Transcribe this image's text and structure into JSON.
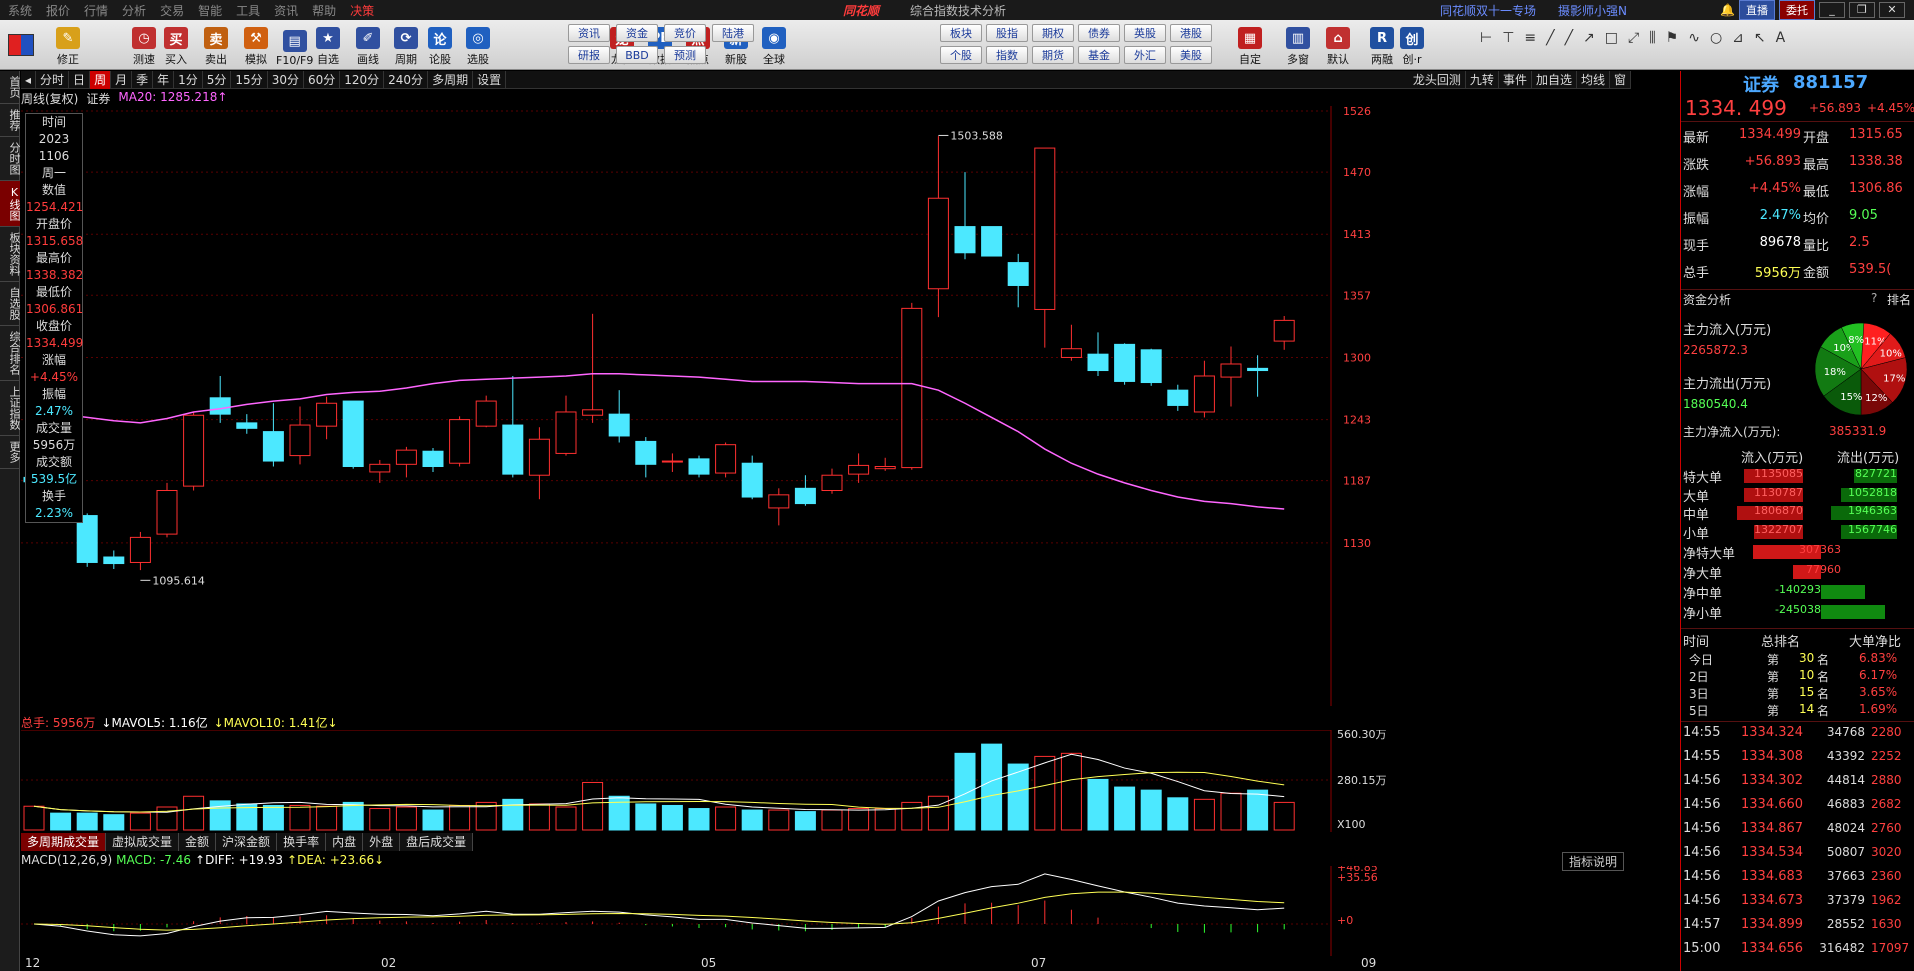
{
  "menu": [
    "系统",
    "报价",
    "行情",
    "分析",
    "交易",
    "智能",
    "工具",
    "资讯",
    "帮助",
    "决策"
  ],
  "brand": "同花顺",
  "window_title": "综合指数技术分析",
  "promo": "同花顺双十一专场",
  "promo2": "摄影师小强N",
  "top_buttons": {
    "live": "直播",
    "entrust": "委托"
  },
  "toolbar": {
    "buttons": [
      "修正",
      "测速",
      "买入",
      "卖出",
      "模拟",
      "F10/F9",
      "自选",
      "画线",
      "周期",
      "论股",
      "选股",
      "龙虎",
      "数据",
      "热点",
      "新股",
      "全球",
      "自定",
      "多窗",
      "默认",
      "两融",
      "创·r"
    ],
    "small": [
      "资讯",
      "资金",
      "竞价",
      "陆港",
      "研报",
      "BBD",
      "预测",
      "板块",
      "股指",
      "期权",
      "债券",
      "英股",
      "港股",
      "个股",
      "指数",
      "期货",
      "基金",
      "外汇",
      "美股"
    ]
  },
  "left_tabs": [
    "首页",
    "推荐",
    "分时图",
    "K线图",
    "板块资料",
    "自选股",
    "综合排名",
    "上证指数",
    "更多"
  ],
  "period_tabs": [
    "分时",
    "日",
    "周",
    "月",
    "季",
    "年",
    "1分",
    "5分",
    "15分",
    "30分",
    "60分",
    "120分",
    "240分",
    "多周期",
    "设置"
  ],
  "period_active": "周",
  "period_right": [
    "龙头回测",
    "九转",
    "事件",
    "加自选",
    "均线",
    "窗"
  ],
  "chart_info": {
    "type": "周线(复权)",
    "name": "证券",
    "ma": "MA20: 1285.218"
  },
  "info_box": [
    {
      "k": "时间",
      "v": "2023",
      "c": "white"
    },
    {
      "k": "",
      "v": "1106",
      "c": "white"
    },
    {
      "k": "周一",
      "v": "",
      "c": "white"
    },
    {
      "k": "数值",
      "v": "1254.421",
      "c": "red"
    },
    {
      "k": "开盘价",
      "v": "1315.658",
      "c": "red"
    },
    {
      "k": "最高价",
      "v": "1338.382",
      "c": "red"
    },
    {
      "k": "最低价",
      "v": "1306.861",
      "c": "red"
    },
    {
      "k": "收盘价",
      "v": "1334.499",
      "c": "red"
    },
    {
      "k": "涨幅",
      "v": "+4.45%",
      "c": "red"
    },
    {
      "k": "振幅",
      "v": "2.47%",
      "c": "cyan"
    },
    {
      "k": "成交量",
      "v": "5956万",
      "c": "white"
    },
    {
      "k": "成交额",
      "v": "539.5亿",
      "c": "cyan"
    },
    {
      "k": "换手",
      "v": "2.23%",
      "c": "cyan"
    }
  ],
  "chart_data": [
    {
      "type": "candlestick",
      "title": "",
      "ylim": [
        1095,
        1526
      ],
      "y_ticks": [
        "1526",
        "1470",
        "1413",
        "1357",
        "1300",
        "1243",
        "1187",
        "1130"
      ],
      "annotations": {
        "high": "1503.588",
        "low": "1095.614"
      },
      "candles": [
        [
          1190,
          1186,
          1215,
          1178
        ],
        [
          1175,
          1155,
          1176,
          1150
        ],
        [
          1155,
          1112,
          1157,
          1108
        ],
        [
          1117,
          1111,
          1123,
          1106
        ],
        [
          1112,
          1135,
          1140,
          1105
        ],
        [
          1138,
          1178,
          1185,
          1135
        ],
        [
          1182,
          1247,
          1250,
          1178
        ],
        [
          1263,
          1248,
          1283,
          1240
        ],
        [
          1240,
          1235,
          1248,
          1230
        ],
        [
          1232,
          1205,
          1258,
          1200
        ],
        [
          1210,
          1238,
          1255,
          1202
        ],
        [
          1237,
          1258,
          1264,
          1225
        ],
        [
          1260,
          1200,
          1260,
          1198
        ],
        [
          1195,
          1202,
          1206,
          1185
        ],
        [
          1202,
          1215,
          1218,
          1190
        ],
        [
          1214,
          1200,
          1217,
          1195
        ],
        [
          1203,
          1243,
          1246,
          1200
        ],
        [
          1237,
          1260,
          1265,
          1236
        ],
        [
          1238,
          1193,
          1283,
          1190
        ],
        [
          1192,
          1225,
          1236,
          1170
        ],
        [
          1212,
          1250,
          1265,
          1210
        ],
        [
          1247,
          1252,
          1340,
          1240
        ],
        [
          1248,
          1228,
          1270,
          1222
        ],
        [
          1223,
          1202,
          1227,
          1190
        ],
        [
          1205,
          1205,
          1212,
          1195
        ],
        [
          1207,
          1193,
          1210,
          1190
        ],
        [
          1194,
          1220,
          1222,
          1190
        ],
        [
          1203,
          1172,
          1210,
          1170
        ],
        [
          1162,
          1174,
          1180,
          1146
        ],
        [
          1180,
          1166,
          1192,
          1164
        ],
        [
          1178,
          1192,
          1198,
          1175
        ],
        [
          1193,
          1201,
          1212,
          1185
        ],
        [
          1198,
          1200,
          1208,
          1196
        ],
        [
          1199,
          1345,
          1350,
          1197
        ],
        [
          1363,
          1446,
          1503,
          1337
        ],
        [
          1420,
          1396,
          1470,
          1390
        ],
        [
          1420,
          1393,
          1420,
          1393
        ],
        [
          1387,
          1366,
          1395,
          1346
        ],
        [
          1344,
          1492,
          1492,
          1309
        ],
        [
          1300,
          1308,
          1330,
          1297
        ],
        [
          1303,
          1288,
          1323,
          1283
        ],
        [
          1312,
          1278,
          1313,
          1275
        ],
        [
          1307,
          1277,
          1308,
          1274
        ],
        [
          1270,
          1256,
          1275,
          1251
        ],
        [
          1250,
          1283,
          1297,
          1245
        ],
        [
          1282,
          1294,
          1310,
          1255
        ],
        [
          1290,
          1288,
          1302,
          1264
        ],
        [
          1315,
          1334,
          1338,
          1307
        ]
      ],
      "ma20": [
        1248,
        1248,
        1245,
        1242,
        1240,
        1244,
        1250,
        1253,
        1257,
        1260,
        1262,
        1266,
        1268,
        1269,
        1272,
        1276,
        1279,
        1280,
        1281,
        1282,
        1283,
        1285,
        1285,
        1284,
        1283,
        1282,
        1280,
        1278,
        1278,
        1278,
        1277,
        1276,
        1276,
        1276,
        1270,
        1258,
        1245,
        1232,
        1216,
        1203,
        1193,
        1185,
        1178,
        1172,
        1168,
        1166,
        1163,
        1161
      ]
    },
    {
      "type": "bar",
      "title": "",
      "ylabel": "X100",
      "y_ticks": [
        "560.30万",
        "280.15万"
      ],
      "legend": {
        "total": "总手: 5956万",
        "mavol5": "MAVOL5: 1.16亿",
        "mavol10": "MAVOL10: 1.41亿"
      },
      "values": [
        155,
        110,
        110,
        100,
        110,
        150,
        220,
        190,
        170,
        160,
        160,
        155,
        180,
        140,
        150,
        130,
        160,
        180,
        200,
        170,
        150,
        310,
        220,
        170,
        160,
        140,
        150,
        130,
        130,
        120,
        130,
        140,
        140,
        180,
        220,
        500,
        560,
        430,
        480,
        500,
        330,
        280,
        260,
        210,
        200,
        240,
        260,
        180
      ],
      "up": [
        1,
        0,
        0,
        0,
        1,
        1,
        1,
        0,
        0,
        0,
        1,
        1,
        0,
        1,
        1,
        0,
        1,
        1,
        0,
        1,
        1,
        1,
        0,
        0,
        0,
        0,
        1,
        0,
        1,
        0,
        1,
        1,
        1,
        1,
        1,
        0,
        0,
        0,
        1,
        1,
        0,
        0,
        0,
        0,
        1,
        1,
        0,
        1
      ]
    },
    {
      "type": "bar",
      "title": "",
      "legend": {
        "name": "MACD(12,26,9)",
        "macd": "MACD: -7.46",
        "diff": "DIFF: +19.93",
        "dea": "DEA: +23.66"
      },
      "y_ticks": [
        "+46.85",
        "+35.56",
        "+0"
      ]
    }
  ],
  "x_labels": [
    "12",
    "02",
    "05",
    "07",
    "09"
  ],
  "volume_tabs": [
    "多周期成交量",
    "虚拟成交量",
    "金额",
    "沪深金额",
    "换手率",
    "内盘",
    "外盘",
    "盘后成交量"
  ],
  "macd_explain": "指标说明",
  "quote": {
    "name": "证券",
    "code": "881157",
    "price": "1334. 499",
    "change": "+56.893",
    "pct": "+4.45%",
    "rows": [
      {
        "l": "最新",
        "v": "1334.499",
        "c": "#ff4040",
        "l2": "开盘",
        "v2": "1315.65"
      },
      {
        "l": "涨跌",
        "v": "+56.893",
        "c": "#ff4040",
        "l2": "最高",
        "v2": "1338.38"
      },
      {
        "l": "涨幅",
        "v": "+4.45%",
        "c": "#ff4040",
        "l2": "最低",
        "v2": "1306.86"
      },
      {
        "l": "振幅",
        "v": "2.47%",
        "c": "#4ce8ff",
        "l2": "均价",
        "v2": "9.05"
      },
      {
        "l": "现手",
        "v": "89678",
        "c": "#ffffff",
        "l2": "量比",
        "v2": "2.5"
      },
      {
        "l": "总手",
        "v": "5956万",
        "c": "#ffff55",
        "l2": "金额",
        "v2": "539.5("
      }
    ]
  },
  "fund": {
    "title": "资金分析",
    "rank": "排名",
    "inflow_label": "主力流入(万元)",
    "inflow": "2265872.3",
    "outflow_label": "主力流出(万元)",
    "outflow": "1880540.4",
    "net_label": "主力净流入(万元):",
    "net": "385331.9",
    "pie": [
      {
        "p": 11,
        "c": "#ff2020",
        "l": "11%"
      },
      {
        "p": 10,
        "c": "#e01a1a",
        "l": "10%"
      },
      {
        "p": 17,
        "c": "#b01010",
        "l": "17%"
      },
      {
        "p": 12,
        "c": "#7a0808",
        "l": "12%"
      },
      {
        "p": 15,
        "c": "#0a5a0a",
        "l": "15%"
      },
      {
        "p": 18,
        "c": "#127a12",
        "l": "18%"
      },
      {
        "p": 10,
        "c": "#1aa01a",
        "l": "10%"
      },
      {
        "p": 8,
        "c": "#22c022",
        "l": "8%"
      }
    ],
    "head": {
      "in": "流入(万元)",
      "out": "流出(万元)"
    },
    "rows": [
      {
        "l": "特大单",
        "in": "1135085",
        "out": "827721",
        "ip": 0.9,
        "op": 0.65
      },
      {
        "l": "大单",
        "in": "1130787",
        "out": "1052818",
        "ip": 0.9,
        "op": 0.85
      },
      {
        "l": "中单",
        "in": "1806870",
        "out": "1946363",
        "ip": 1,
        "op": 1
      },
      {
        "l": "小单",
        "in": "1322707",
        "out": "1567746",
        "ip": 0.75,
        "op": 0.85
      }
    ],
    "net_rows": [
      {
        "l": "净特大单",
        "v": "307363",
        "pos": 1,
        "p": 0.85
      },
      {
        "l": "净大单",
        "v": "77960",
        "pos": 1,
        "p": 0.35
      },
      {
        "l": "净中单",
        "v": "-140293",
        "pos": 0,
        "p": 0.55
      },
      {
        "l": "净小单",
        "v": "-245038",
        "pos": 0,
        "p": 0.8
      }
    ]
  },
  "rank": {
    "head": [
      "时间",
      "总排名",
      "大单净比"
    ],
    "rows": [
      {
        "t": "今日",
        "r": "30",
        "p": "6.83%"
      },
      {
        "t": "2日",
        "r": "10",
        "p": "6.17%"
      },
      {
        "t": "3日",
        "r": "15",
        "p": "3.65%"
      },
      {
        "t": "5日",
        "r": "14",
        "p": "1.69%"
      }
    ],
    "pre": "第",
    "suf": "名"
  },
  "ticks": [
    {
      "t": "14:55",
      "p": "1334.324",
      "v": "34768",
      "x": "2280"
    },
    {
      "t": "14:55",
      "p": "1334.308",
      "v": "43392",
      "x": "2252"
    },
    {
      "t": "14:56",
      "p": "1334.302",
      "v": "44814",
      "x": "2880"
    },
    {
      "t": "14:56",
      "p": "1334.660",
      "v": "46883",
      "x": "2682"
    },
    {
      "t": "14:56",
      "p": "1334.867",
      "v": "48024",
      "x": "2760"
    },
    {
      "t": "14:56",
      "p": "1334.534",
      "v": "50807",
      "x": "3020"
    },
    {
      "t": "14:56",
      "p": "1334.683",
      "v": "37663",
      "x": "2360"
    },
    {
      "t": "14:56",
      "p": "1334.673",
      "v": "37379",
      "x": "1962"
    },
    {
      "t": "14:57",
      "p": "1334.899",
      "v": "28552",
      "x": "1630"
    },
    {
      "t": "15:00",
      "p": "1334.656",
      "v": "316482",
      "x": "17097"
    }
  ]
}
